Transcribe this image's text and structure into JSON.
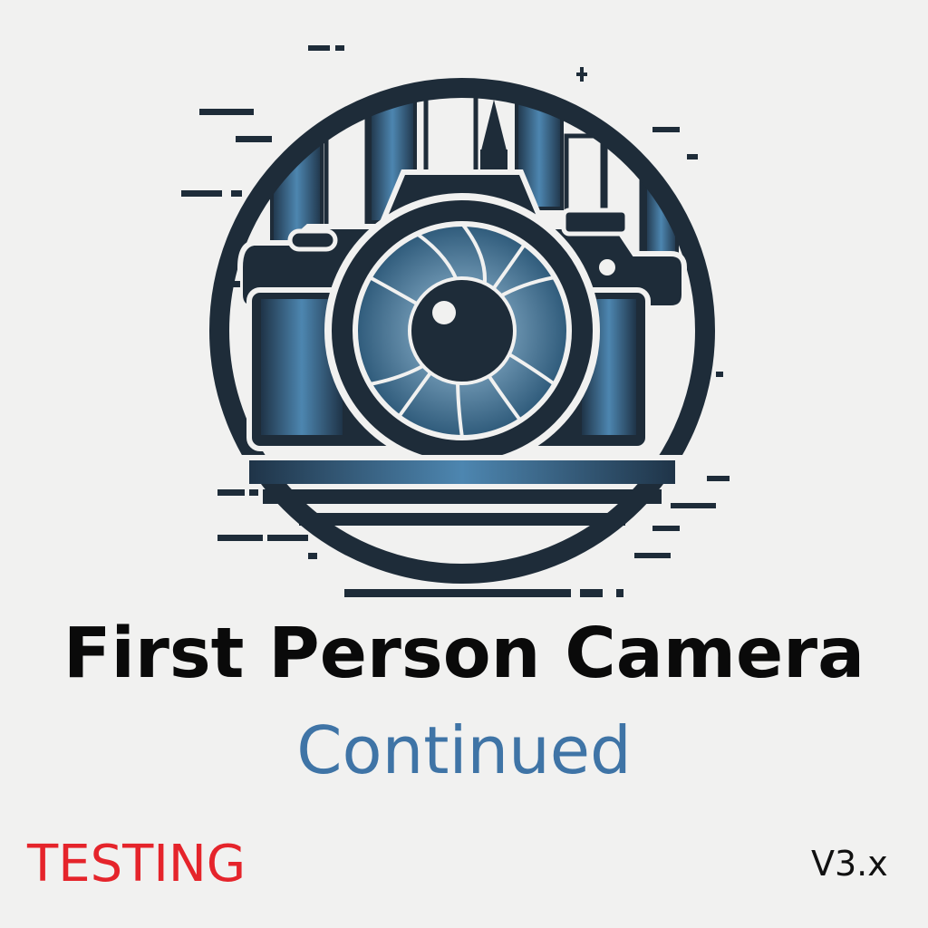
{
  "title": "First Person Camera",
  "subtitle": "Continued",
  "badge": "TESTING",
  "version": "V3.x",
  "logo": {
    "icon": "camera-city-icon"
  },
  "colors": {
    "background": "#f1f1f0",
    "title": "#0a0a0a",
    "subtitle": "#3f74a6",
    "badge": "#e5242b",
    "logo_dark": "#1e2c39",
    "logo_blue": "#3d6f96",
    "logo_light_blue": "#8fb6d0"
  }
}
